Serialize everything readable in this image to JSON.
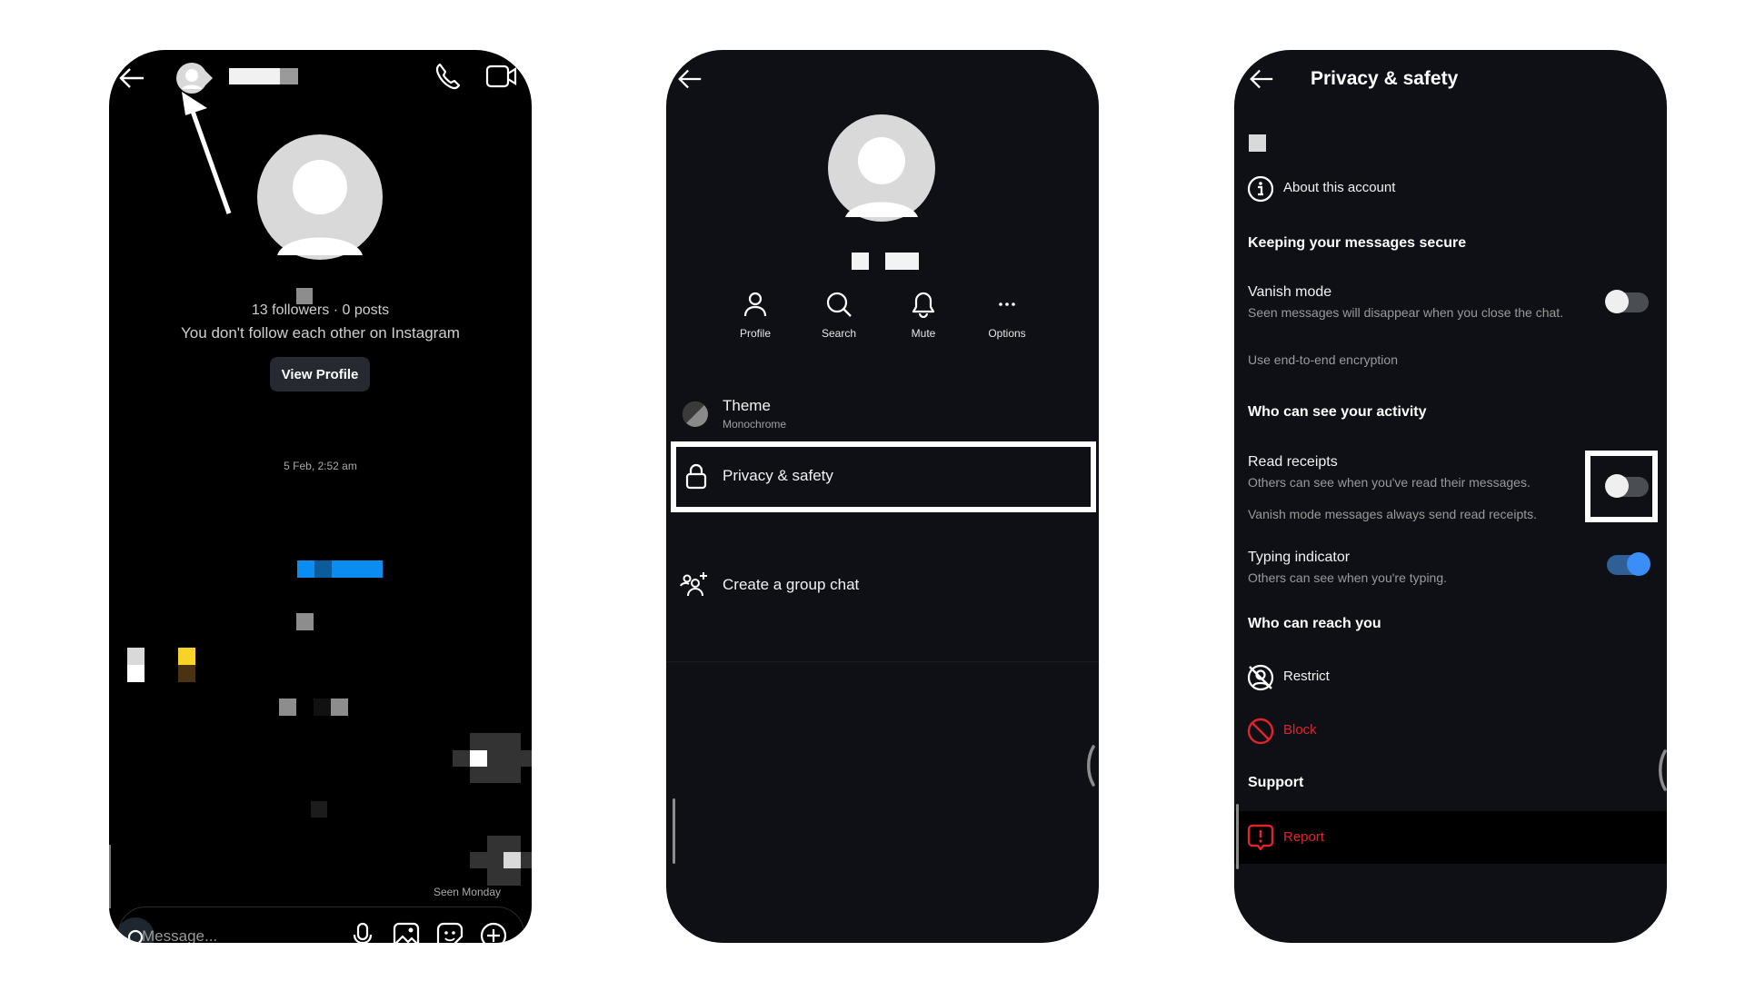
{
  "chat_screen": {
    "stats": "13 followers · 0 posts",
    "follow_status": "You don't follow each other on Instagram",
    "view_profile_label": "View Profile",
    "timestamp": "5 Feb, 2:52 am",
    "seen_label": "Seen Monday",
    "message_placeholder": "Message...",
    "icons": [
      "back-arrow-icon",
      "avatar-icon",
      "phone-icon",
      "video-icon",
      "camera-icon",
      "mic-icon",
      "gallery-icon",
      "sticker-icon",
      "plus-icon"
    ]
  },
  "details_screen": {
    "actions": [
      {
        "label": "Profile",
        "icon": "person-icon"
      },
      {
        "label": "Search",
        "icon": "search-icon"
      },
      {
        "label": "Mute",
        "icon": "bell-icon"
      },
      {
        "label": "Options",
        "icon": "more-icon"
      }
    ],
    "theme_title": "Theme",
    "theme_value": "Monochrome",
    "privacy_label": "Privacy & safety",
    "group_chat_label": "Create a group chat"
  },
  "privacy_screen": {
    "title": "Privacy & safety",
    "about_label": "About this account",
    "section_secure": "Keeping your messages secure",
    "vanish_title": "Vanish mode",
    "vanish_sub": "Seen messages will disappear when you close the chat.",
    "vanish_on": false,
    "e2e_label": "Use end-to-end encryption",
    "section_activity": "Who can see your activity",
    "read_title": "Read receipts",
    "read_sub": "Others can see when you've read their messages.",
    "read_note": "Vanish mode messages always send read receipts.",
    "read_on": false,
    "typing_title": "Typing indicator",
    "typing_sub": "Others can see when you're typing.",
    "typing_on": true,
    "section_reach": "Who can reach you",
    "restrict_label": "Restrict",
    "block_label": "Block",
    "section_support": "Support",
    "report_label": "Report"
  },
  "colors": {
    "accent_blue": "#3a8ef6",
    "danger_red": "#e0242b",
    "panel_bg": "#0e1015"
  }
}
